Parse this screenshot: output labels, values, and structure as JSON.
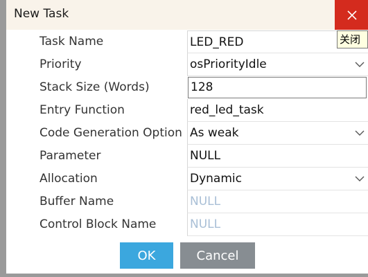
{
  "dialog": {
    "title": "New Task",
    "close_tooltip": "关闭"
  },
  "fields": [
    {
      "label": "Task Name",
      "value": "LED_RED",
      "kind": "text"
    },
    {
      "label": "Priority",
      "value": "osPriorityIdle",
      "kind": "select"
    },
    {
      "label": "Stack Size (Words)",
      "value": "128",
      "kind": "input"
    },
    {
      "label": "Entry Function",
      "value": "red_led_task",
      "kind": "text"
    },
    {
      "label": "Code Generation Option",
      "value": "As weak",
      "kind": "select"
    },
    {
      "label": "Parameter",
      "value": "NULL",
      "kind": "text"
    },
    {
      "label": "Allocation",
      "value": "Dynamic",
      "kind": "select"
    },
    {
      "label": "Buffer Name",
      "placeholder": "NULL",
      "kind": "placeholder"
    },
    {
      "label": "Control Block Name",
      "placeholder": "NULL",
      "kind": "placeholder"
    }
  ],
  "buttons": {
    "ok": "OK",
    "cancel": "Cancel"
  },
  "colors": {
    "close_bg": "#d42b1e",
    "ok_bg": "#3ba7de",
    "cancel_bg": "#878d92",
    "placeholder_text": "#a9bfd6"
  }
}
